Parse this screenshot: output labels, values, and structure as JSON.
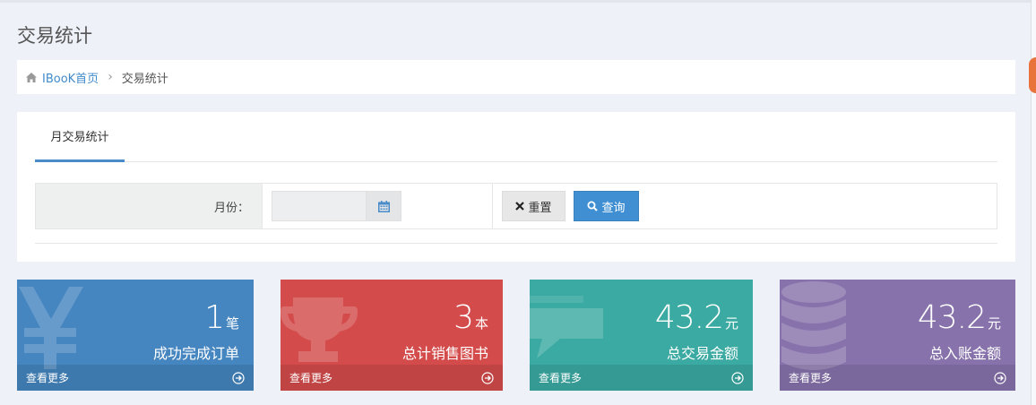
{
  "page": {
    "title": "交易统计"
  },
  "breadcrumb": {
    "home": "IBooK首页",
    "separator": "›",
    "current": "交易统计"
  },
  "tabs": [
    {
      "label": "月交易统计",
      "active": true
    }
  ],
  "filter": {
    "month_label": "月份：",
    "month_value": "",
    "reset_label": "重置",
    "query_label": "查询"
  },
  "stats": [
    {
      "value": "1",
      "unit": "笔",
      "label": "成功完成订单",
      "more": "查看更多",
      "color": "#4585c0",
      "icon": "yen-icon"
    },
    {
      "value": "3",
      "unit": "本",
      "label": "总计销售图书",
      "more": "查看更多",
      "color": "#d44b4b",
      "icon": "trophy-icon"
    },
    {
      "value": "43.2",
      "unit": "元",
      "label": "总交易金额",
      "more": "查看更多",
      "color": "#3aaaa2",
      "icon": "chat-icon"
    },
    {
      "value": "43.2",
      "unit": "元",
      "label": "总入账金额",
      "more": "查看更多",
      "color": "#8772ab",
      "icon": "database-icon"
    }
  ]
}
